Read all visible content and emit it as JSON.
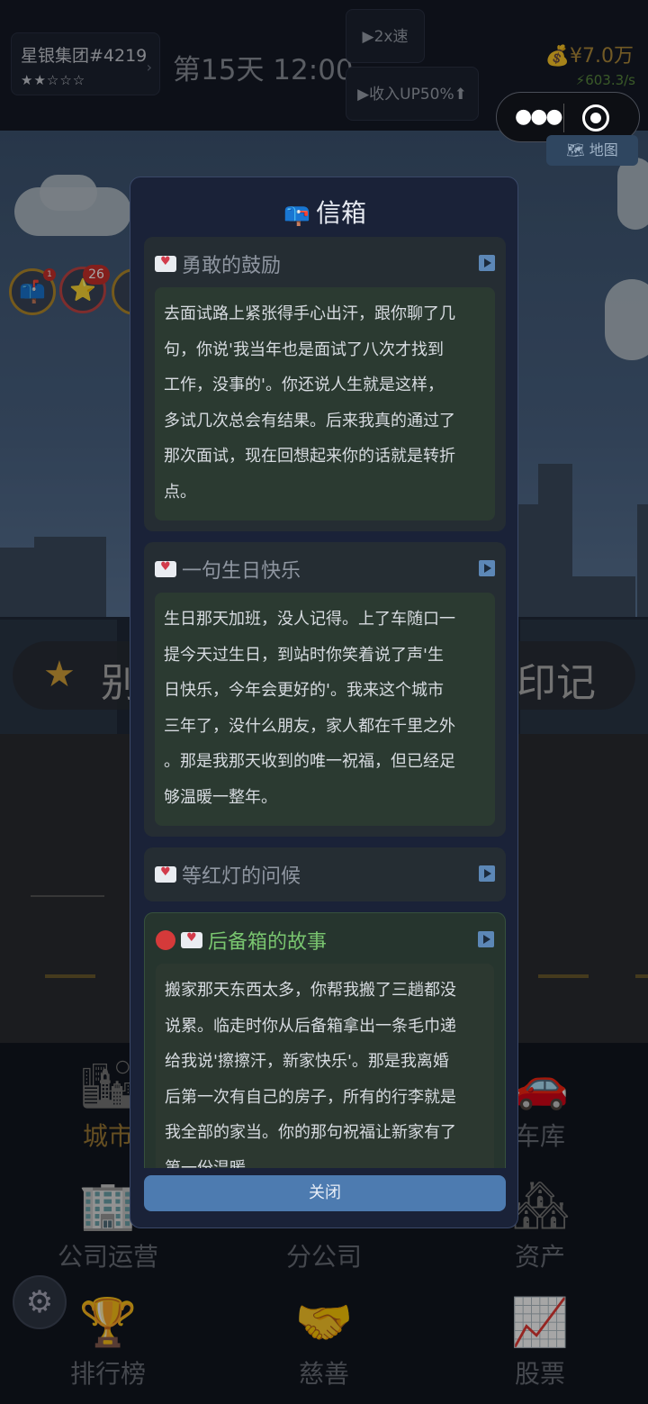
{
  "topbar": {
    "company_name": "星银集团#4219",
    "company_stars": "★★☆☆☆",
    "day_time": "第15天 12:00",
    "speed_label": "▶2x速",
    "income_label": "▶收入UP50%⬆",
    "money": "💰¥7.0万",
    "rate": "⚡603.3/s",
    "map_label": "地图"
  },
  "side_icons": {
    "badge_count": "26",
    "dot_count": "1"
  },
  "banner": {
    "left_text": "别",
    "right_text": "印记"
  },
  "mailbox": {
    "title": "信箱",
    "letters": [
      {
        "title": "勇敢的鼓励",
        "unread": false,
        "lines": [
          "去面试路上紧张得手心出汗，跟你聊了几",
          "句，你说'我当年也是面试了八次才找到",
          "工作，没事的'。你还说人生就是这样，",
          "多试几次总会有结果。后来我真的通过了",
          "那次面试，现在回想起来你的话就是转折",
          "点。"
        ]
      },
      {
        "title": "一句生日快乐",
        "unread": false,
        "lines": [
          "生日那天加班，没人记得。上了车随口一",
          "提今天过生日，到站时你笑着说了声'生",
          "日快乐，今年会更好的'。我来这个城市",
          "三年了，没什么朋友，家人都在千里之外",
          "。那是我那天收到的唯一祝福，但已经足",
          "够温暖一整年。"
        ]
      },
      {
        "title": "等红灯的问候",
        "unread": false,
        "lines": []
      },
      {
        "title": "后备箱的故事",
        "unread": true,
        "lines": [
          "搬家那天东西太多，你帮我搬了三趟都没",
          "说累。临走时你从后备箱拿出一条毛巾递",
          "给我说'擦擦汗，新家快乐'。那是我离婚",
          "后第一次有自己的房子，所有的行李就是",
          "我全部的家当。你的那句祝福让新家有了",
          "第一份温暖。"
        ]
      }
    ],
    "close_label": "关闭"
  },
  "nav": {
    "items": [
      {
        "label": "城市",
        "icon": "city-icon"
      },
      {
        "label": "车库",
        "icon": "car-icon"
      },
      {
        "label": "公司运营",
        "icon": "office-building-icon"
      },
      {
        "label": "分公司",
        "icon": "branch-icon"
      },
      {
        "label": "资产",
        "icon": "houses-icon"
      },
      {
        "label": "排行榜",
        "icon": "trophy-icon"
      },
      {
        "label": "慈善",
        "icon": "handshake-icon"
      },
      {
        "label": "股票",
        "icon": "stock-chart-icon"
      }
    ]
  },
  "colors": {
    "modal_bg": "#1a2238",
    "unread_title": "#79c56f",
    "close_button": "#4d7bb0",
    "gold": "#b08a3a"
  }
}
